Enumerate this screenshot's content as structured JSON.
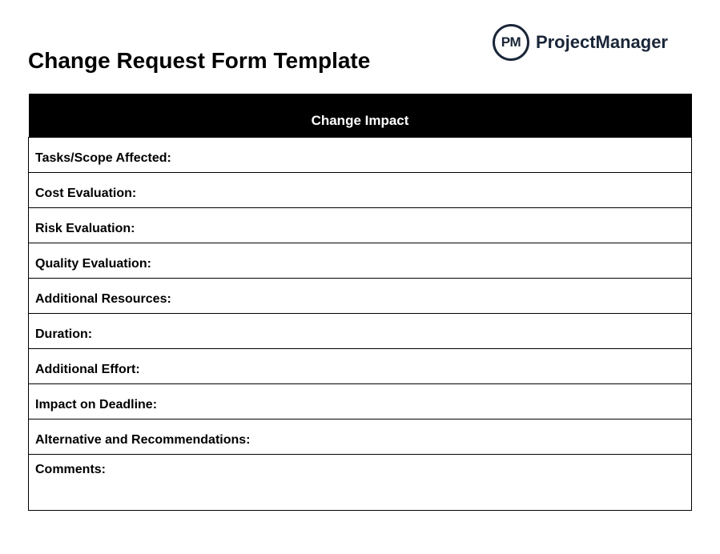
{
  "header": {
    "title": "Change Request Form Template",
    "logo_initials": "PM",
    "logo_text": "ProjectManager"
  },
  "section": {
    "heading": "Change Impact"
  },
  "fields": [
    {
      "label": "Tasks/Scope Affected:"
    },
    {
      "label": "Cost Evaluation:"
    },
    {
      "label": "Risk Evaluation:"
    },
    {
      "label": "Quality Evaluation:"
    },
    {
      "label": "Additional Resources:"
    },
    {
      "label": "Duration:"
    },
    {
      "label": "Additional Effort:"
    },
    {
      "label": "Impact on Deadline:"
    },
    {
      "label": "Alternative and Recommendations:"
    }
  ],
  "comments": {
    "label": "Comments:"
  }
}
